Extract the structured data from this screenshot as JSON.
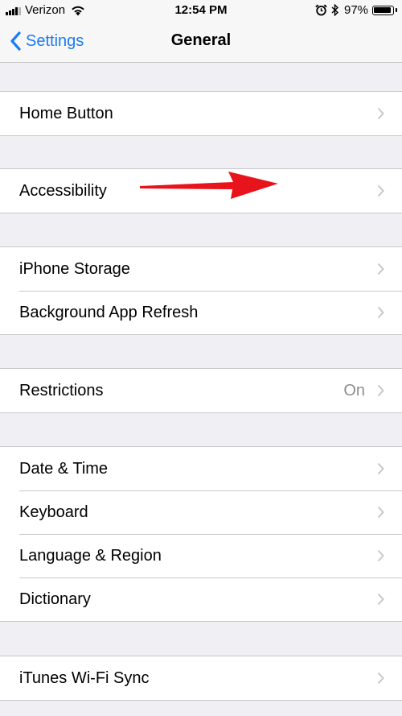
{
  "status_bar": {
    "carrier": "Verizon",
    "time": "12:54 PM",
    "battery_percent": "97%",
    "icons": [
      "signal-icon",
      "wifi-icon",
      "alarm-icon",
      "bluetooth-icon",
      "battery-icon"
    ]
  },
  "nav_bar": {
    "back_label": "Settings",
    "title": "General"
  },
  "groups": [
    {
      "rows": [
        {
          "label": "Home Button"
        }
      ]
    },
    {
      "rows": [
        {
          "label": "Accessibility"
        }
      ]
    },
    {
      "rows": [
        {
          "label": "iPhone Storage"
        },
        {
          "label": "Background App Refresh"
        }
      ]
    },
    {
      "rows": [
        {
          "label": "Restrictions",
          "value": "On"
        }
      ]
    },
    {
      "rows": [
        {
          "label": "Date & Time"
        },
        {
          "label": "Keyboard"
        },
        {
          "label": "Language & Region"
        },
        {
          "label": "Dictionary"
        }
      ]
    },
    {
      "rows": [
        {
          "label": "iTunes Wi-Fi Sync"
        }
      ]
    }
  ],
  "colors": {
    "tint": "#1a7cf4",
    "background": "#efeff4",
    "separator": "#c8c7cc",
    "chevron": "#c7c7cc",
    "annotation_arrow": "#e8141b"
  }
}
